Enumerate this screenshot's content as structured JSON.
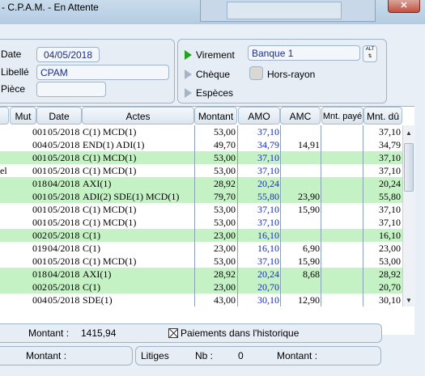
{
  "window": {
    "title": "- C.P.A.M. - En Attente",
    "close_label": "✕"
  },
  "form": {
    "date_label": "Date",
    "date_value": "04/05/2018",
    "libelle_label": "Libellé",
    "libelle_value": "CPAM",
    "piece_label": "Pièce",
    "piece_value": ""
  },
  "payment": {
    "virement_label": "Virement",
    "cheque_label": "Chèque",
    "especes_label": "Espèces",
    "selected": "virement",
    "bank_value": "Banque 1",
    "alt_label": "ALT",
    "hors_rayon_label": "Hors-rayon"
  },
  "table": {
    "columns": [
      "Mut",
      "Date",
      "Actes",
      "Montant",
      "AMO",
      "AMC",
      "Mnt. payé",
      "Mnt. dû"
    ],
    "rows": [
      {
        "left": "",
        "mut": "001",
        "date": "05/2018",
        "actes": "C(1) MCD(1)",
        "montant": "53,00",
        "amo": "37,10",
        "amc": "",
        "paye": "",
        "du": "37,10",
        "green": false
      },
      {
        "left": "",
        "mut": "004",
        "date": "05/2018",
        "actes": "END(1) ADI(1)",
        "montant": "49,70",
        "amo": "34,79",
        "amc": "14,91",
        "paye": "",
        "du": "34,79",
        "green": false
      },
      {
        "left": "",
        "mut": "001",
        "date": "05/2018",
        "actes": "C(1) MCD(1)",
        "montant": "53,00",
        "amo": "37,10",
        "amc": "",
        "paye": "",
        "du": "37,10",
        "green": true
      },
      {
        "left": "el",
        "mut": "001",
        "date": "05/2018",
        "actes": "C(1) MCD(1)",
        "montant": "53,00",
        "amo": "37,10",
        "amc": "",
        "paye": "",
        "du": "37,10",
        "green": false
      },
      {
        "left": "",
        "mut": "018",
        "date": "04/2018",
        "actes": "AXI(1)",
        "montant": "28,92",
        "amo": "20,24",
        "amc": "",
        "paye": "",
        "du": "20,24",
        "green": true
      },
      {
        "left": "",
        "mut": "001",
        "date": "05/2018",
        "actes": "ADI(2) SDE(1) MCD(1)",
        "montant": "79,70",
        "amo": "55,80",
        "amc": "23,90",
        "paye": "",
        "du": "55,80",
        "green": true
      },
      {
        "left": "",
        "mut": "001",
        "date": "05/2018",
        "actes": "C(1) MCD(1)",
        "montant": "53,00",
        "amo": "37,10",
        "amc": "15,90",
        "paye": "",
        "du": "37,10",
        "green": false
      },
      {
        "left": "",
        "mut": "001",
        "date": "05/2018",
        "actes": "C(1) MCD(1)",
        "montant": "53,00",
        "amo": "37,10",
        "amc": "",
        "paye": "",
        "du": "37,10",
        "green": false
      },
      {
        "left": "",
        "mut": "002",
        "date": "05/2018",
        "actes": "C(1)",
        "montant": "23,00",
        "amo": "16,10",
        "amc": "",
        "paye": "",
        "du": "16,10",
        "green": true
      },
      {
        "left": "",
        "mut": "019",
        "date": "04/2018",
        "actes": "C(1)",
        "montant": "23,00",
        "amo": "16,10",
        "amc": "6,90",
        "paye": "",
        "du": "23,00",
        "green": false
      },
      {
        "left": "",
        "mut": "001",
        "date": "05/2018",
        "actes": "C(1) MCD(1)",
        "montant": "53,00",
        "amo": "37,10",
        "amc": "15,90",
        "paye": "",
        "du": "53,00",
        "green": false
      },
      {
        "left": "",
        "mut": "018",
        "date": "04/2018",
        "actes": "AXI(1)",
        "montant": "28,92",
        "amo": "20,24",
        "amc": "8,68",
        "paye": "",
        "du": "28,92",
        "green": true
      },
      {
        "left": "",
        "mut": "002",
        "date": "05/2018",
        "actes": "C(1)",
        "montant": "23,00",
        "amo": "20,70",
        "amc": "",
        "paye": "",
        "du": "20,70",
        "green": true
      },
      {
        "left": "",
        "mut": "004",
        "date": "05/2018",
        "actes": "SDE(1)",
        "montant": "43,00",
        "amo": "30,10",
        "amc": "12,90",
        "paye": "",
        "du": "30,10",
        "green": false
      }
    ]
  },
  "footer": {
    "montant_label": "Montant :",
    "montant_value": "1415,94",
    "historique_label": "Paiements dans l'historique",
    "montant2_label": "Montant :",
    "litiges_label": "Litiges",
    "nb_label": "Nb :",
    "nb_value": "0",
    "montant3_label": "Montant :"
  }
}
